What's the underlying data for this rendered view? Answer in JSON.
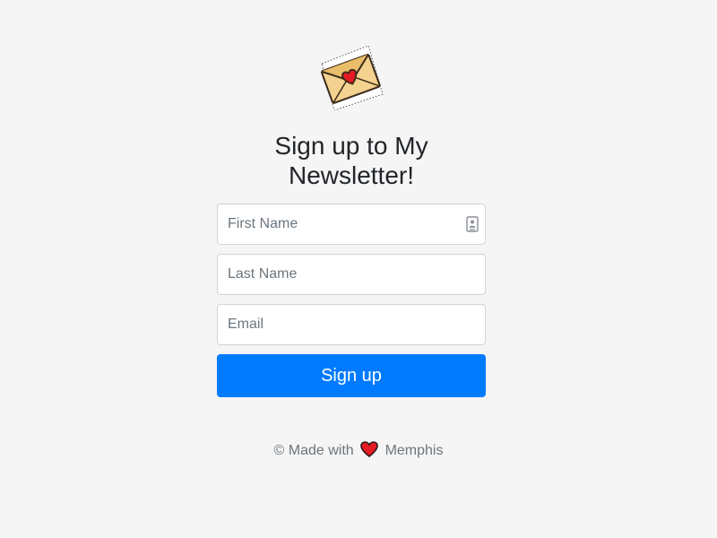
{
  "logo": {
    "icon": "envelope-heart-icon"
  },
  "title": "Sign up to My Newsletter!",
  "form": {
    "first_name_placeholder": "First Name",
    "last_name_placeholder": "Last Name",
    "email_placeholder": "Email",
    "submit_label": "Sign up"
  },
  "footer": {
    "prefix": "© Made with",
    "heart_icon": "heart-icon",
    "suffix": "Memphis"
  },
  "colors": {
    "background": "#f5f5f5",
    "primary": "#007bff",
    "heart": "#e41b23"
  }
}
